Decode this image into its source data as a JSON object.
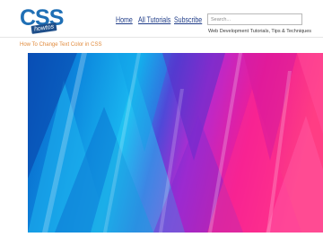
{
  "logo": {
    "main_text": "CSS",
    "badge_text": "howtos"
  },
  "nav": {
    "home": "Home",
    "all_tutorials": "All Tutorials",
    "subscribe": "Subscribe"
  },
  "search": {
    "placeholder": "Search..."
  },
  "tagline": "Web Development Tutorials, Tips & Techniques",
  "breadcrumb": "How To Change Text Color in CSS",
  "colors": {
    "link": "#1f3c88",
    "breadcrumb": "#e08a3c",
    "logo": "#1f6fb5",
    "hero_left": "#0a86d8",
    "hero_right": "#ff1f8e"
  }
}
